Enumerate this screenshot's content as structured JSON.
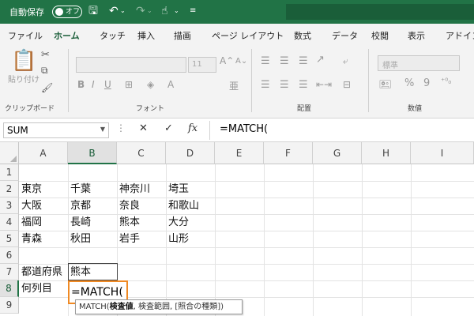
{
  "titlebar": {
    "autosave_label": "自動保存",
    "autosave_state": "オフ",
    "icons": [
      "save-icon",
      "undo-icon",
      "redo-icon",
      "touch-mode-icon",
      "customize-qat-icon"
    ]
  },
  "tabs": [
    "ファイル",
    "ホーム",
    "タッチ",
    "挿入",
    "描画",
    "ページ レイアウト",
    "数式",
    "データ",
    "校閲",
    "表示",
    "アドイン"
  ],
  "active_tab": "ホーム",
  "ribbon": {
    "groups": {
      "clipboard": "クリップボード",
      "font": "フォント",
      "alignment": "配置",
      "number": "数値"
    },
    "paste_label": "貼り付け",
    "font_size": "11",
    "number_format": "標準"
  },
  "formula_bar": {
    "name_box": "SUM",
    "fx": "fx",
    "formula": "=MATCH("
  },
  "grid": {
    "columns": [
      "A",
      "B",
      "C",
      "D",
      "E",
      "F",
      "G",
      "H",
      "I"
    ],
    "rows": [
      "1",
      "2",
      "3",
      "4",
      "5",
      "6",
      "7",
      "8",
      "9"
    ],
    "cells": {
      "A2": "東京",
      "B2": "千葉",
      "C2": "神奈川",
      "D2": "埼玉",
      "A3": "大阪",
      "B3": "京都",
      "C3": "奈良",
      "D3": "和歌山",
      "A4": "福岡",
      "B4": "長崎",
      "C4": "熊本",
      "D4": "大分",
      "A5": "青森",
      "B5": "秋田",
      "C5": "岩手",
      "D5": "山形",
      "A7": "都道府県",
      "B7": "熊本",
      "A8": "何列目",
      "B8": "=MATCH("
    }
  },
  "tooltip": {
    "func": "MATCH(",
    "arg1": "検査値",
    "rest": ", 検査範囲, [照合の種類])"
  },
  "colors": {
    "accent": "#217346",
    "active_cell_border": "#f08a24"
  }
}
